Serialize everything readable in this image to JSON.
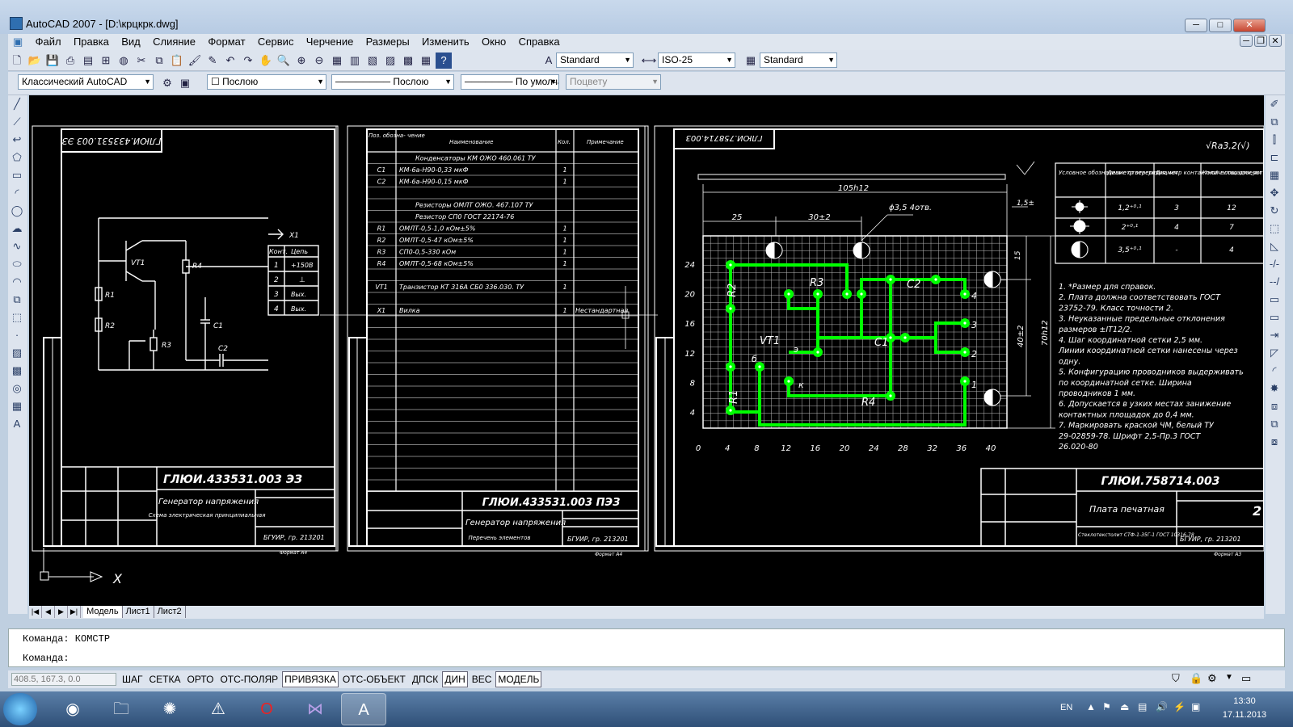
{
  "window": {
    "title": "AutoCAD 2007 - [D:\\крцкрк.dwg]",
    "minimize": "─",
    "maximize": "□",
    "close": "✕"
  },
  "menu": [
    "Файл",
    "Правка",
    "Вид",
    "Слияние",
    "Формат",
    "Сервис",
    "Черчение",
    "Размеры",
    "Изменить",
    "Окно",
    "Справка"
  ],
  "toolbar1": {
    "text_style": "Standard",
    "dim_style": "ISO-25",
    "table_style": "Standard"
  },
  "toolbar2": {
    "workspace": "Классический AutoCAD",
    "layer": "Послою",
    "linetype": "Послою",
    "lineweight": "По умолчан",
    "plotstyle": "Поцвету"
  },
  "layout_tabs": [
    "Модель",
    "Лист1",
    "Лист2"
  ],
  "command_lines": [
    "Команда:  КОМСТР",
    "Команда:"
  ],
  "status": {
    "coords": "408.5, 167.3, 0.0",
    "buttons": [
      {
        "label": "ШАГ",
        "on": false
      },
      {
        "label": "СЕТКА",
        "on": false
      },
      {
        "label": "ОРТО",
        "on": false
      },
      {
        "label": "ОТС-ПОЛЯР",
        "on": false
      },
      {
        "label": "ПРИВЯЗКА",
        "on": true
      },
      {
        "label": "ОТС-ОБЪЕКТ",
        "on": false
      },
      {
        "label": "ДПСК",
        "on": false
      },
      {
        "label": "ДИН",
        "on": true
      },
      {
        "label": "ВЕС",
        "on": false
      },
      {
        "label": "МОДЕЛЬ",
        "on": true
      }
    ]
  },
  "tray": {
    "lang": "EN",
    "time": "13:30",
    "date": "17.11.2013"
  },
  "drawing": {
    "sheet1": {
      "stamp_top": "ГЛЮИ.433531.003 ЭЗ",
      "stamp_title": "ГЛЮИ.433531.003 ЭЗ",
      "product": "Генератор напряжения",
      "doc_type": "Схема электрическая принципиальная",
      "org": "БГУИР, гр. 213201",
      "format": "Формат А4",
      "conn_header": "X1",
      "conn_cols": [
        "Конт.",
        "Цепь"
      ],
      "conn_rows": [
        [
          "1",
          "+150В"
        ],
        [
          "2",
          "⊥"
        ],
        [
          "3",
          "Вых."
        ],
        [
          "4",
          "Вых."
        ]
      ],
      "components": [
        "VT1",
        "R1",
        "R2",
        "R3",
        "R4",
        "C1",
        "C2"
      ]
    },
    "sheet2": {
      "stamp_title": "ГЛЮИ.433531.003 ПЭЗ",
      "product": "Генератор напряжения",
      "doc_type": "Перечень элементов",
      "org": "БГУИР, гр. 213201",
      "format": "Формат А4",
      "headers": [
        "Поз. обозна- чение",
        "Наименование",
        "Кол.",
        "Примечание"
      ],
      "rows": [
        [
          "",
          "Конденсаторы КМ ОЖО 460.061 ТУ",
          "",
          ""
        ],
        [
          "C1",
          "КМ-6а-Н90-0,33 мкФ",
          "1",
          ""
        ],
        [
          "C2",
          "КМ-6а-Н90-0,15 мкФ",
          "1",
          ""
        ],
        [
          "",
          "Резисторы ОМЛТ ОЖО. 467.107 ТУ",
          "",
          ""
        ],
        [
          "",
          "Резистор СП0 ГОСТ 22174-76",
          "",
          ""
        ],
        [
          "R1",
          "ОМЛТ-0,5-1,0 кОм±5%",
          "1",
          ""
        ],
        [
          "R2",
          "ОМЛТ-0,5-47 кОм±5%",
          "1",
          ""
        ],
        [
          "R3",
          "СП0-0,5-330 кОм",
          "1",
          ""
        ],
        [
          "R4",
          "ОМЛТ-0,5-68 кОм±5%",
          "1",
          ""
        ],
        [
          "VT1",
          "Транзистор КТ 316А СБ0 336.030. ТУ",
          "1",
          ""
        ],
        [
          "X1",
          "Вилка",
          "1",
          "Нестандартная"
        ]
      ]
    },
    "sheet3": {
      "stamp_top": "ГЛЮИ.758714.003",
      "stamp_title": "ГЛЮИ.758714.003",
      "doc_type": "Плата печатная",
      "material": "Стеклотекстолит СТФ-1-35Г-1 ГОСТ 10316-78",
      "org": "БГУИР, гр. 213201",
      "format": "Формат А3",
      "roughness": "√Ra3,2(√)",
      "dim_width": "105h12",
      "dim_25": "25",
      "dim_30": "30±2",
      "dim_hole": "ϕ3,5 4отв.",
      "dim_15": "15",
      "dim_40": "40±2",
      "dim_70": "70h12",
      "dim_1_5": "1,5±",
      "x_ticks": [
        "0",
        "4",
        "8",
        "12",
        "16",
        "20",
        "24",
        "28",
        "32",
        "36",
        "40"
      ],
      "y_ticks": [
        "4",
        "8",
        "12",
        "16",
        "20",
        "24"
      ],
      "labels": [
        "R2",
        "R3",
        "C2",
        "VT1",
        "C1",
        "R1",
        "R4",
        "б",
        "э",
        "к",
        "1",
        "2",
        "3",
        "4"
      ],
      "hole_table_headers": [
        "Условное обозначение отверстия",
        "Диаметр отверстия, мм",
        "Диаметр контактной площадки,мм",
        "Количество отверстий"
      ],
      "hole_table_rows": [
        [
          "",
          "1,2⁺⁰·¹",
          "3",
          "12"
        ],
        [
          "",
          "2⁺⁰·¹",
          "4",
          "7"
        ],
        [
          "",
          "3,5⁺⁰·¹",
          "-",
          "4"
        ]
      ],
      "notes": [
        "1. *Размер для справок.",
        "2. Плата должна соответствовать ГОСТ",
        "   23752-79. Класс точности 2.",
        "3. Неуказанные предельные отклонения",
        "   размеров ±IT12/2.",
        "4. Шаг координатной сетки 2,5 мм.",
        "   Линии координатной сетки нанесены через",
        "   одну.",
        "5. Конфигурацию проводников выдерживать",
        "   по координатной сетке. Ширина",
        "   проводников 1 мм.",
        "6. Допускается в узких местах занижение",
        "   контактных площадок до 0,4 мм.",
        "7. Маркировать краской ЧМ, белый ТУ",
        "   29-02859-78. Шрифт 2,5-Пр.3 ГОСТ",
        "   26.020-80"
      ],
      "sheet_no": "2"
    },
    "ucs_label": "X",
    "colors": {
      "trace": "#00ff00",
      "line": "#ffffff",
      "bg": "#000000"
    }
  }
}
